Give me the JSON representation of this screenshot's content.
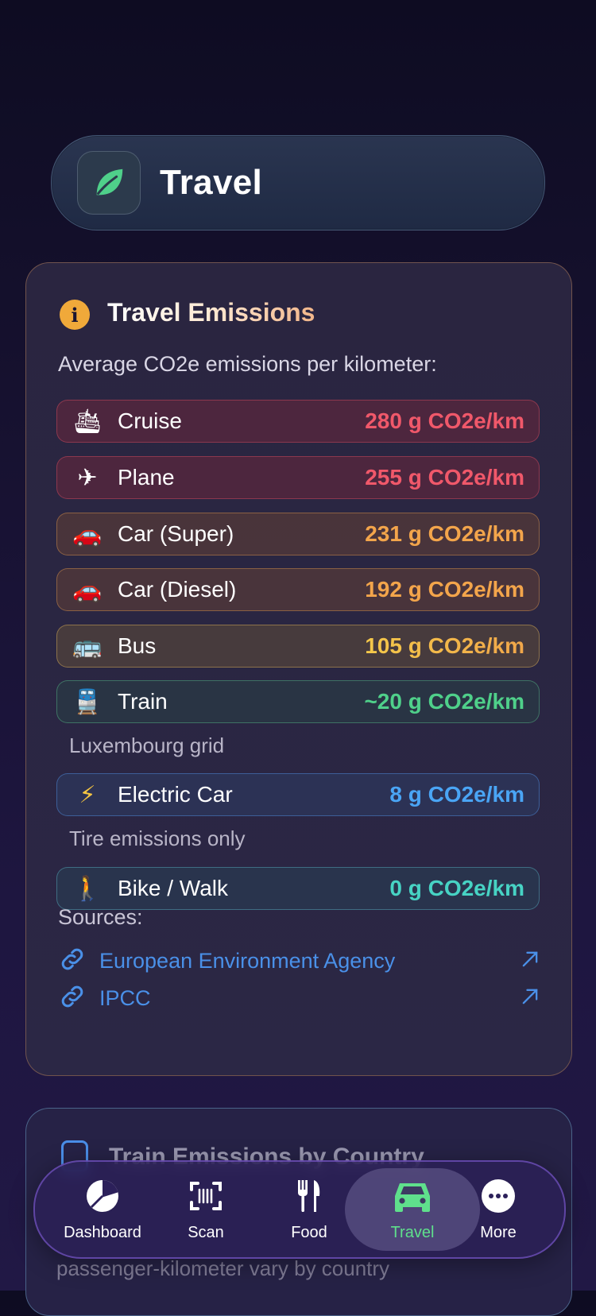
{
  "header": {
    "title": "Travel",
    "icon": "leaf-icon"
  },
  "emissions_card": {
    "title": "Travel Emissions",
    "subtitle": "Average CO2e emissions per kilometer:",
    "rows": [
      {
        "emoji": "🛳",
        "icon": "cruise-ship-icon",
        "label": "Cruise",
        "value": "280 g CO2e/km"
      },
      {
        "emoji": "✈",
        "icon": "airplane-icon",
        "label": "Plane",
        "value": "255 g CO2e/km"
      },
      {
        "emoji": "🚗",
        "icon": "car-icon",
        "label": "Car (Super)",
        "value": "231 g CO2e/km"
      },
      {
        "emoji": "🚗",
        "icon": "car-icon",
        "label": "Car (Diesel)",
        "value": "192 g CO2e/km"
      },
      {
        "emoji": "🚌",
        "icon": "bus-icon",
        "label": "Bus",
        "value": "105 g CO2e/km"
      },
      {
        "emoji": "🚆",
        "icon": "train-icon",
        "label": "Train",
        "value": "~20 g CO2e/km",
        "note": "Luxembourg grid"
      },
      {
        "emoji": "⚡",
        "icon": "lightning-icon",
        "label": "Electric Car",
        "value": "8 g CO2e/km",
        "note": "Tire emissions only"
      },
      {
        "emoji": "🚶",
        "icon": "walking-person-icon",
        "label": "Bike / Walk",
        "value": "0 g CO2e/km"
      }
    ],
    "sources_label": "Sources:",
    "sources": [
      {
        "label": "European Environment Agency"
      },
      {
        "label": "IPCC"
      }
    ]
  },
  "second_card": {
    "title": "Train Emissions by Country",
    "subtitle": "passenger-kilometer vary by country"
  },
  "tabbar": {
    "tabs": [
      {
        "label": "Dashboard",
        "icon": "pie-chart-icon"
      },
      {
        "label": "Scan",
        "icon": "barcode-scan-icon"
      },
      {
        "label": "Food",
        "icon": "fork-knife-icon"
      },
      {
        "label": "Travel",
        "icon": "car-icon",
        "active": true
      },
      {
        "label": "More",
        "icon": "more-icon"
      }
    ]
  },
  "colors": {
    "accent_active": "#5fe08c",
    "link": "#4a90e8",
    "info": "#f0a93a"
  }
}
